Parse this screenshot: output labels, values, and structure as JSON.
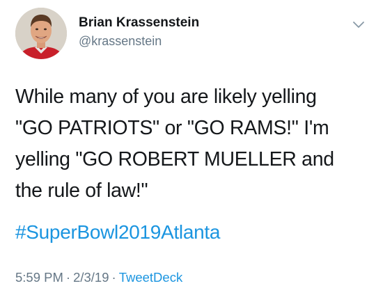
{
  "author": {
    "name": "Brian Krassenstein",
    "handle": "@krassenstein",
    "avatar_icon": "profile-photo"
  },
  "tweet": {
    "lines": [
      "While many of you are likely yelling",
      "\"GO PATRIOTS\" or \"GO RAMS!\" I'm",
      "yelling \"GO ROBERT MUELLER and",
      "the rule of law!\""
    ],
    "hashtag": "#SuperBowl2019Atlanta"
  },
  "meta": {
    "time": "5:59 PM",
    "separator": "·",
    "date": "2/3/19",
    "source": "TweetDeck"
  },
  "menu": {
    "icon": "chevron-down-icon"
  },
  "colors": {
    "link": "#1b95e0",
    "secondary_text": "#657786",
    "primary_text": "#14171a"
  }
}
